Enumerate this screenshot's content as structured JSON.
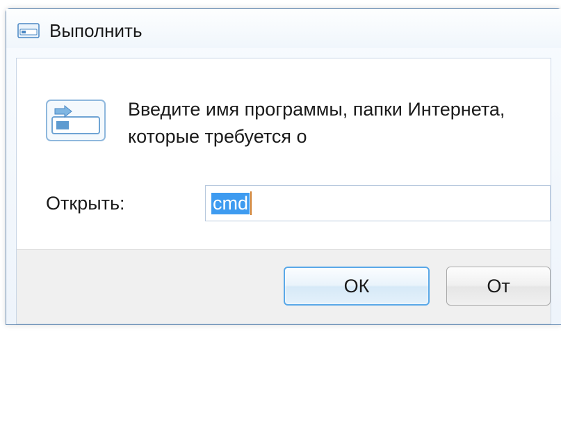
{
  "titlebar": {
    "title": "Выполнить"
  },
  "content": {
    "info_text": "Введите имя программы, папки Интернета, которые требуется о",
    "open_label": "Открыть:",
    "input_value": "cmd"
  },
  "buttons": {
    "ok": "ОК",
    "cancel": "От"
  }
}
